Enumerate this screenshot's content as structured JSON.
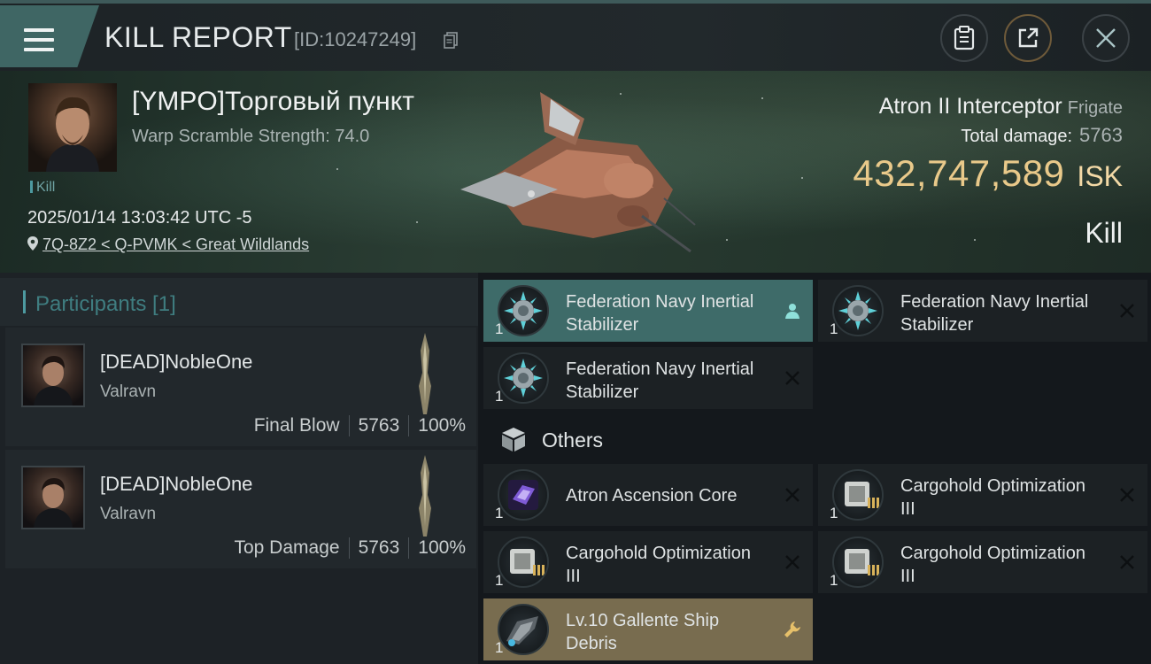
{
  "header": {
    "title": "KILL REPORT",
    "report_id": "[ID:10247249]",
    "menu_icon": "hamburger-menu-icon",
    "buttons": [
      "clipboard-icon",
      "share-icon",
      "close-icon"
    ]
  },
  "victim": {
    "name": "[YMPO]Торговый пункт",
    "warp_scramble": "Warp Scramble Strength: 74.0",
    "kill_tag": "Kill",
    "datetime": "2025/01/14 13:03:42 UTC -5",
    "location": "7Q-8Z2 < Q-PVMK < Great Wildlands"
  },
  "ship": {
    "name": "Atron II Interceptor",
    "class": "Frigate",
    "total_damage_label": "Total damage:",
    "total_damage": "5763",
    "isk_value": "432,747,589",
    "isk_unit": "ISK",
    "result": "Kill"
  },
  "participants": {
    "title": "Participants [1]",
    "rows": [
      {
        "name": "[DEAD]NobleOne",
        "ship": "Valravn",
        "role": "Final Blow",
        "damage": "5763",
        "percent": "100%"
      },
      {
        "name": "[DEAD]NobleOne",
        "ship": "Valravn",
        "role": "Top Damage",
        "damage": "5763",
        "percent": "100%"
      }
    ]
  },
  "items": {
    "modules": [
      {
        "name": "Federation Navy Inertial Stabilizer",
        "qty": "1",
        "state": "selected",
        "action": "person-icon"
      },
      {
        "name": "Federation Navy Inertial Stabilizer",
        "qty": "1",
        "state": "normal",
        "action": "close-icon"
      },
      {
        "name": "Federation Navy Inertial Stabilizer",
        "qty": "1",
        "state": "normal",
        "action": "close-icon"
      }
    ],
    "others_label": "Others",
    "others": [
      {
        "name": "Atron Ascension Core",
        "qty": "1",
        "state": "normal",
        "action": "close-icon"
      },
      {
        "name": "Cargohold Optimization III",
        "qty": "1",
        "state": "normal",
        "action": "close-icon"
      },
      {
        "name": "Cargohold Optimization III",
        "qty": "1",
        "state": "normal",
        "action": "close-icon"
      },
      {
        "name": "Cargohold Optimization III",
        "qty": "1",
        "state": "normal",
        "action": "close-icon"
      },
      {
        "name": "Lv.10 Gallente Ship Debris",
        "qty": "1",
        "state": "gold",
        "action": "wrench-icon"
      }
    ]
  },
  "colors": {
    "accent_teal": "#3e6b69",
    "isk_gold": "#e9c98a",
    "debris_gold": "#786c4f"
  }
}
